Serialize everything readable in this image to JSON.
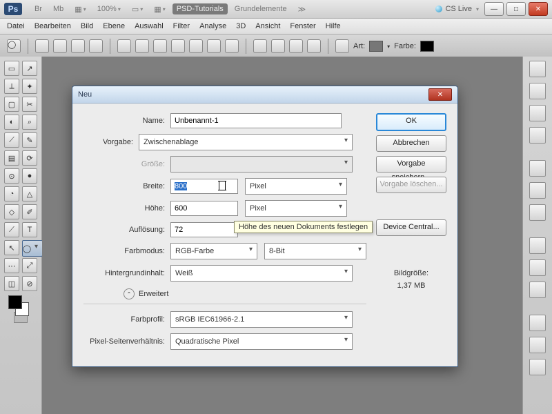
{
  "titlebar": {
    "logo": "Ps",
    "br": "Br",
    "mb": "Mb",
    "zoom": "100%",
    "active_tab": "PSD-Tutorials",
    "inactive_tab": "Grundelemente",
    "cslive": "CS Live"
  },
  "menu": [
    "Datei",
    "Bearbeiten",
    "Bild",
    "Ebene",
    "Auswahl",
    "Filter",
    "Analyse",
    "3D",
    "Ansicht",
    "Fenster",
    "Hilfe"
  ],
  "optionbar": {
    "art_label": "Art:",
    "farbe_label": "Farbe:"
  },
  "toolbox": [
    "▭",
    "↗",
    "⟂",
    "✦",
    "▢",
    "✂",
    "◐",
    "⌕",
    "⟋",
    "✎",
    "▤",
    "⟳",
    "⊙",
    "●",
    "◔",
    "△",
    "◇",
    "✐",
    "⟋",
    "T",
    "↖",
    "◯",
    "⋯",
    "⤢",
    "◫",
    "⊘"
  ],
  "dialog": {
    "title": "Neu",
    "labels": {
      "name": "Name:",
      "vorgabe": "Vorgabe:",
      "groesse": "Größe:",
      "breite": "Breite:",
      "hoehe": "Höhe:",
      "aufloesung": "Auflösung:",
      "farbmodus": "Farbmodus:",
      "hintergrund": "Hintergrundinhalt:",
      "erweitert": "Erweitert",
      "farbprofil": "Farbprofil:",
      "pixelsv": "Pixel-Seitenverhältnis:"
    },
    "values": {
      "name": "Unbenannt-1",
      "vorgabe": "Zwischenablage",
      "breite": "800",
      "breite_unit": "Pixel",
      "hoehe": "600",
      "hoehe_unit": "Pixel",
      "aufloesung": "72",
      "farbmodus": "RGB-Farbe",
      "bit": "8-Bit",
      "hintergrund": "Weiß",
      "farbprofil": "sRGB IEC61966-2.1",
      "pixelsv": "Quadratische Pixel"
    },
    "buttons": {
      "ok": "OK",
      "cancel": "Abbrechen",
      "save_preset": "Vorgabe speichern...",
      "delete_preset": "Vorgabe löschen...",
      "device_central": "Device Central..."
    },
    "sizeinfo_label": "Bildgröße:",
    "sizeinfo_value": "1,37 MB",
    "tooltip": "Höhe des neuen Dokuments festlegen"
  }
}
